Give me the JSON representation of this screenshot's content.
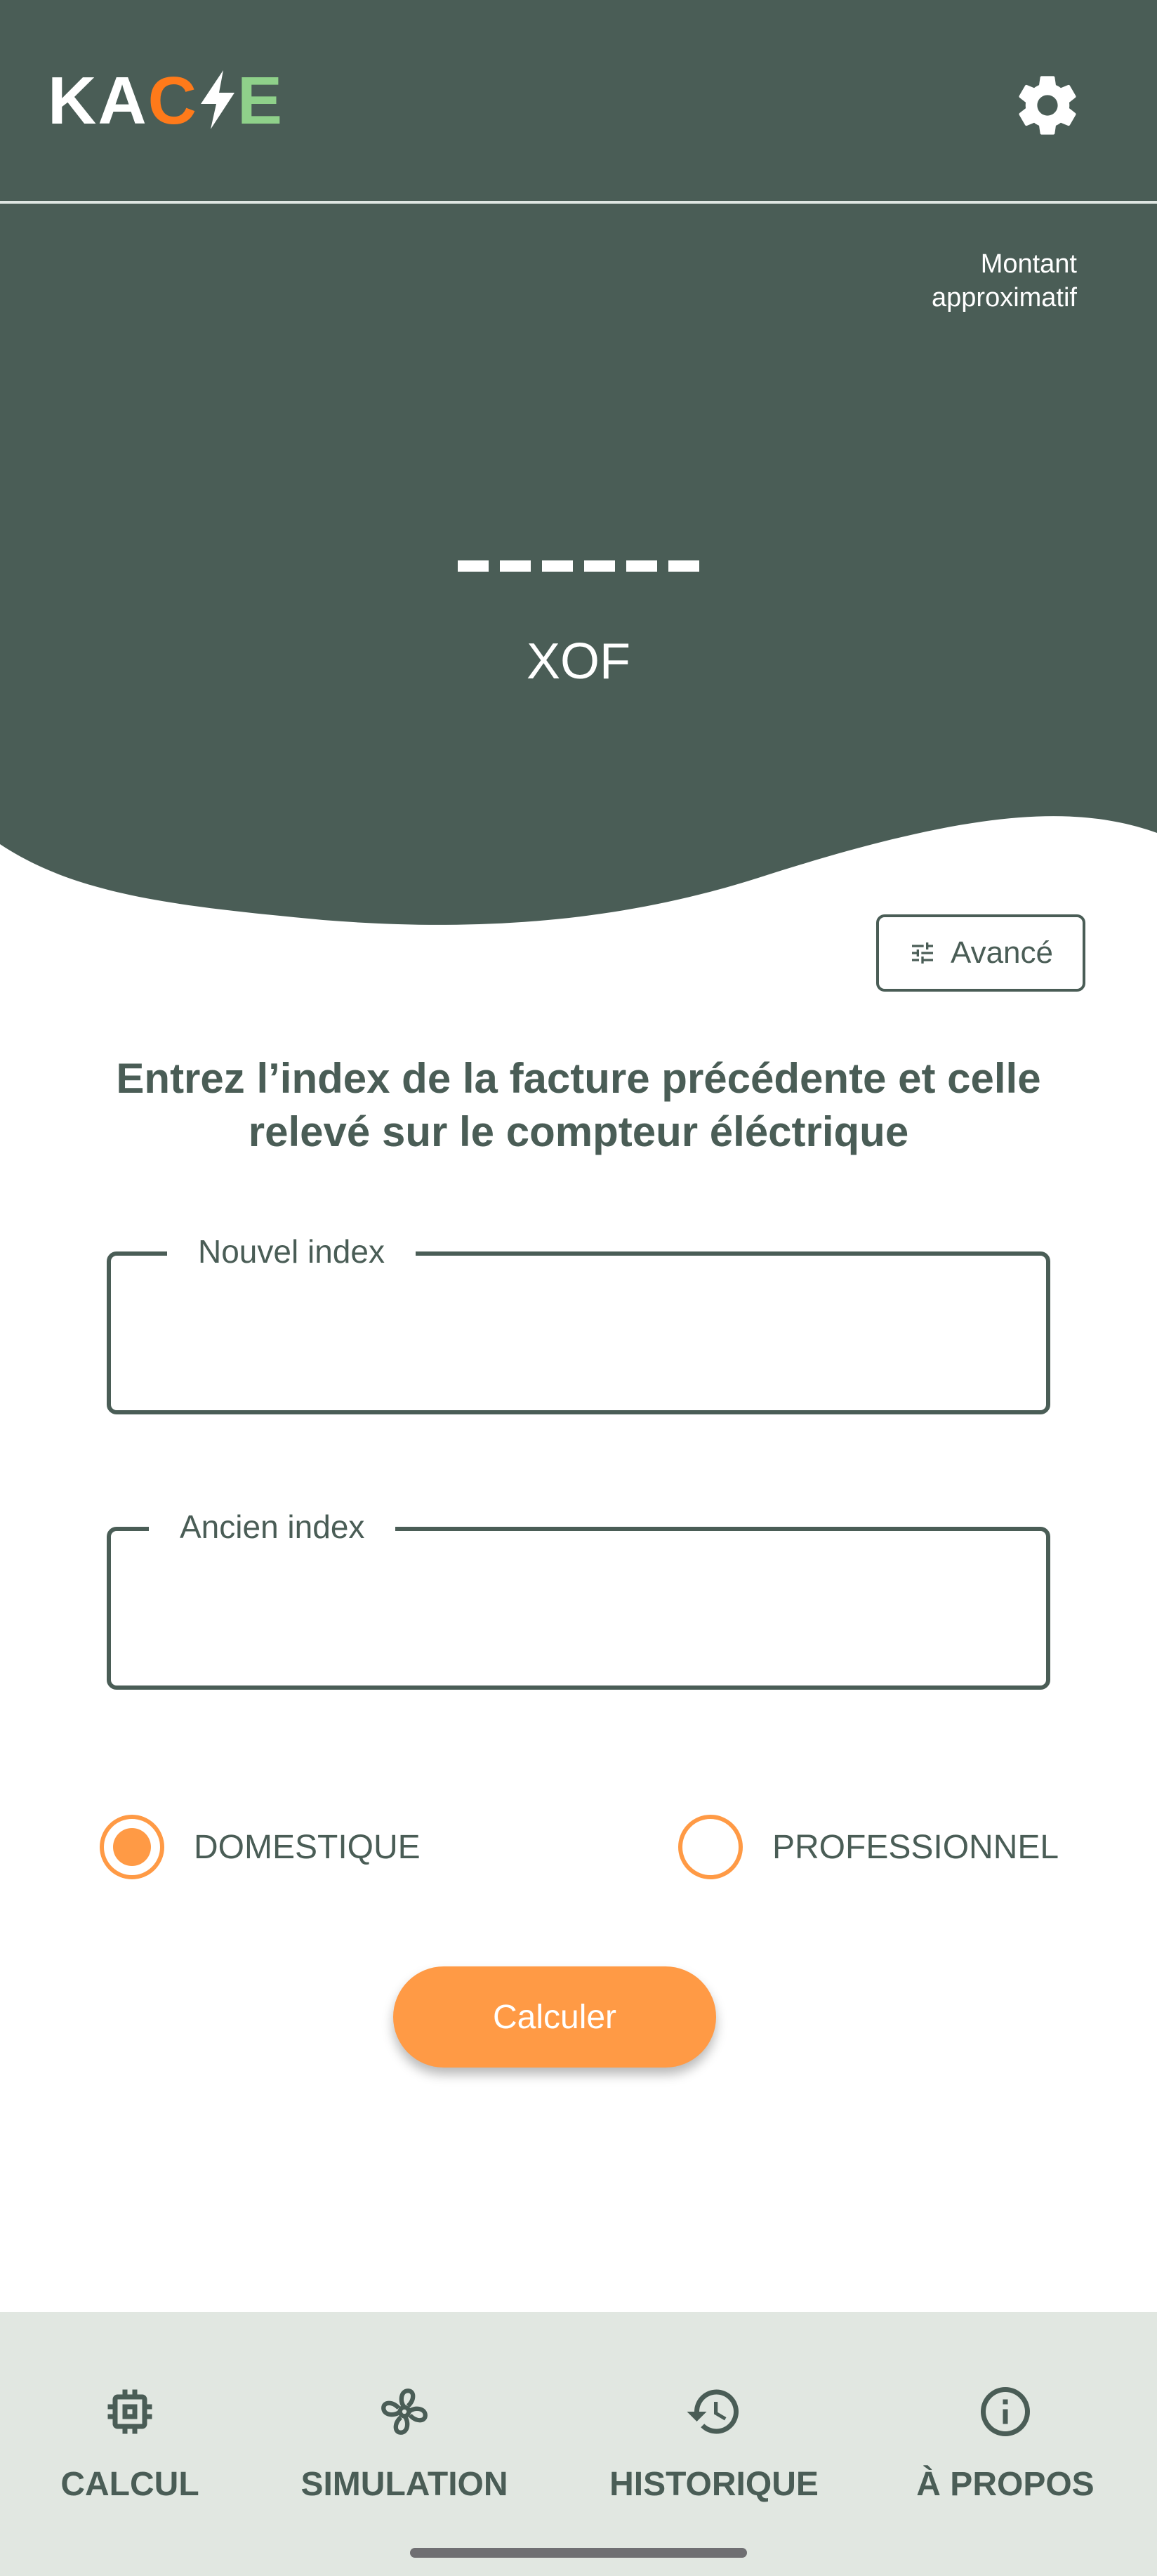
{
  "header": {
    "logo": {
      "part1": "KA",
      "part2": "C",
      "part3": "E"
    }
  },
  "hero": {
    "approx_label": "Montant approximatif",
    "amount_placeholder": "------",
    "currency": "XOF"
  },
  "advanced_button": {
    "label": "Avancé"
  },
  "instruction": "Entrez l’index de la facture précédente et celle relevé sur le compteur éléctrique",
  "fields": {
    "new_index": {
      "label": "Nouvel index",
      "value": ""
    },
    "old_index": {
      "label": "Ancien index",
      "value": ""
    }
  },
  "radios": {
    "domestic": {
      "label": "DOMESTIQUE",
      "selected": true
    },
    "professional": {
      "label": "PROFESSIONNEL",
      "selected": false
    }
  },
  "calculate_button": {
    "label": "Calculer"
  },
  "nav": {
    "items": [
      {
        "label": "CALCUL",
        "icon": "chip-icon"
      },
      {
        "label": "SIMULATION",
        "icon": "fan-icon"
      },
      {
        "label": "HISTORIQUE",
        "icon": "history-icon"
      },
      {
        "label": "À PROPOS",
        "icon": "info-icon"
      }
    ]
  },
  "colors": {
    "primary": "#4a5d56",
    "accent": "#ff9a45",
    "logo_orange": "#ff7a1a",
    "logo_green": "#8fd18a",
    "nav_background": "#e1e7e1"
  }
}
